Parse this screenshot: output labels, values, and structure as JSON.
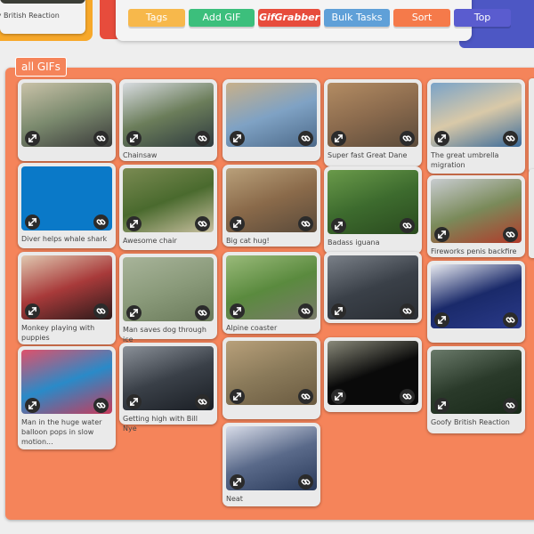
{
  "top": {
    "prev_caption": "fy British Reaction"
  },
  "toolbar": {
    "buttons": [
      {
        "label": "Tags",
        "color": "#f7b84b"
      },
      {
        "label": "Add GIF",
        "color": "#3cbf7c"
      },
      {
        "label": "GifGrabber",
        "color": "#e74c3c"
      },
      {
        "label": "Bulk Tasks",
        "color": "#5fa0d8"
      },
      {
        "label": "Sort",
        "color": "#f57a4a"
      },
      {
        "label": "Top",
        "color": "#5a5ccf"
      }
    ]
  },
  "section": {
    "label": "all GIFs",
    "panel_color": "#f5845a"
  },
  "gifs": [
    {
      "caption": "",
      "colors": [
        "#7b8a6e",
        "#c9c2a8",
        "#3a3a3a"
      ]
    },
    {
      "caption": "Chainsaw",
      "colors": [
        "#6b7d5a",
        "#d7dbe0",
        "#2e3a3f"
      ]
    },
    {
      "caption": "",
      "colors": [
        "#7fa2c4",
        "#c7b08a",
        "#4d6a8a"
      ]
    },
    {
      "caption": "Super fast Great Dane",
      "colors": [
        "#8a6a4d",
        "#b38c63",
        "#5a4a3a"
      ]
    },
    {
      "caption": "The great umbrella migration",
      "colors": [
        "#d9c9a8",
        "#7aa3c8",
        "#3a6a9a"
      ]
    },
    {
      "caption": "Diver helps whale shark",
      "colors": [
        "#0a79c8",
        "#0a79c8",
        "#0a79c8"
      ]
    },
    {
      "caption": "Awesome chair",
      "colors": [
        "#4a6a2e",
        "#7a8a52",
        "#c9c0a0"
      ]
    },
    {
      "caption": "Big cat hug!",
      "colors": [
        "#8a6a4a",
        "#b9a07a",
        "#5a4a3a"
      ]
    },
    {
      "caption": "Badass iguana",
      "colors": [
        "#3d6b2e",
        "#6a9a4a",
        "#2a4a1e"
      ]
    },
    {
      "caption": "Fireworks penis backfire",
      "colors": [
        "#7a8a5a",
        "#c8ccd0",
        "#b23a2a"
      ]
    },
    {
      "caption": "Monkey playing with puppies",
      "colors": [
        "#a83a3a",
        "#e0c8b0",
        "#2a1a1a"
      ]
    },
    {
      "caption": "Man saves dog through ice",
      "colors": [
        "#8a9a7a",
        "#a8b49a",
        "#6a7a5a"
      ]
    },
    {
      "caption": "Alpine coaster",
      "colors": [
        "#5a8a3e",
        "#9aba7a",
        "#7a7a6a"
      ]
    },
    {
      "caption": "",
      "colors": [
        "#3a4048",
        "#7a8088",
        "#2a2e34"
      ]
    },
    {
      "caption": "",
      "colors": [
        "#1a2a6a",
        "#e8eaf0",
        "#2a3a8a"
      ]
    },
    {
      "caption": "Man in the huge water balloon pops in slow motion...",
      "colors": [
        "#2a8ac8",
        "#e0506a",
        "#c83a5a"
      ]
    },
    {
      "caption": "Getting high with Bill Nye",
      "colors": [
        "#3a4048",
        "#8a9098",
        "#1a1e24"
      ]
    },
    {
      "caption": "",
      "colors": [
        "#8a7a5a",
        "#b8a07a",
        "#6a5a40"
      ]
    },
    {
      "caption": "",
      "colors": [
        "#0a0a0a",
        "#8a8a7a",
        "#0a0a0a"
      ]
    },
    {
      "caption": "Goofy British Reaction",
      "colors": [
        "#2a3a2a",
        "#6a7a6a",
        "#1a2a1a"
      ]
    },
    {
      "caption": "Neat",
      "colors": [
        "#5a6a8a",
        "#d8dce8",
        "#2a3a5a"
      ]
    }
  ]
}
